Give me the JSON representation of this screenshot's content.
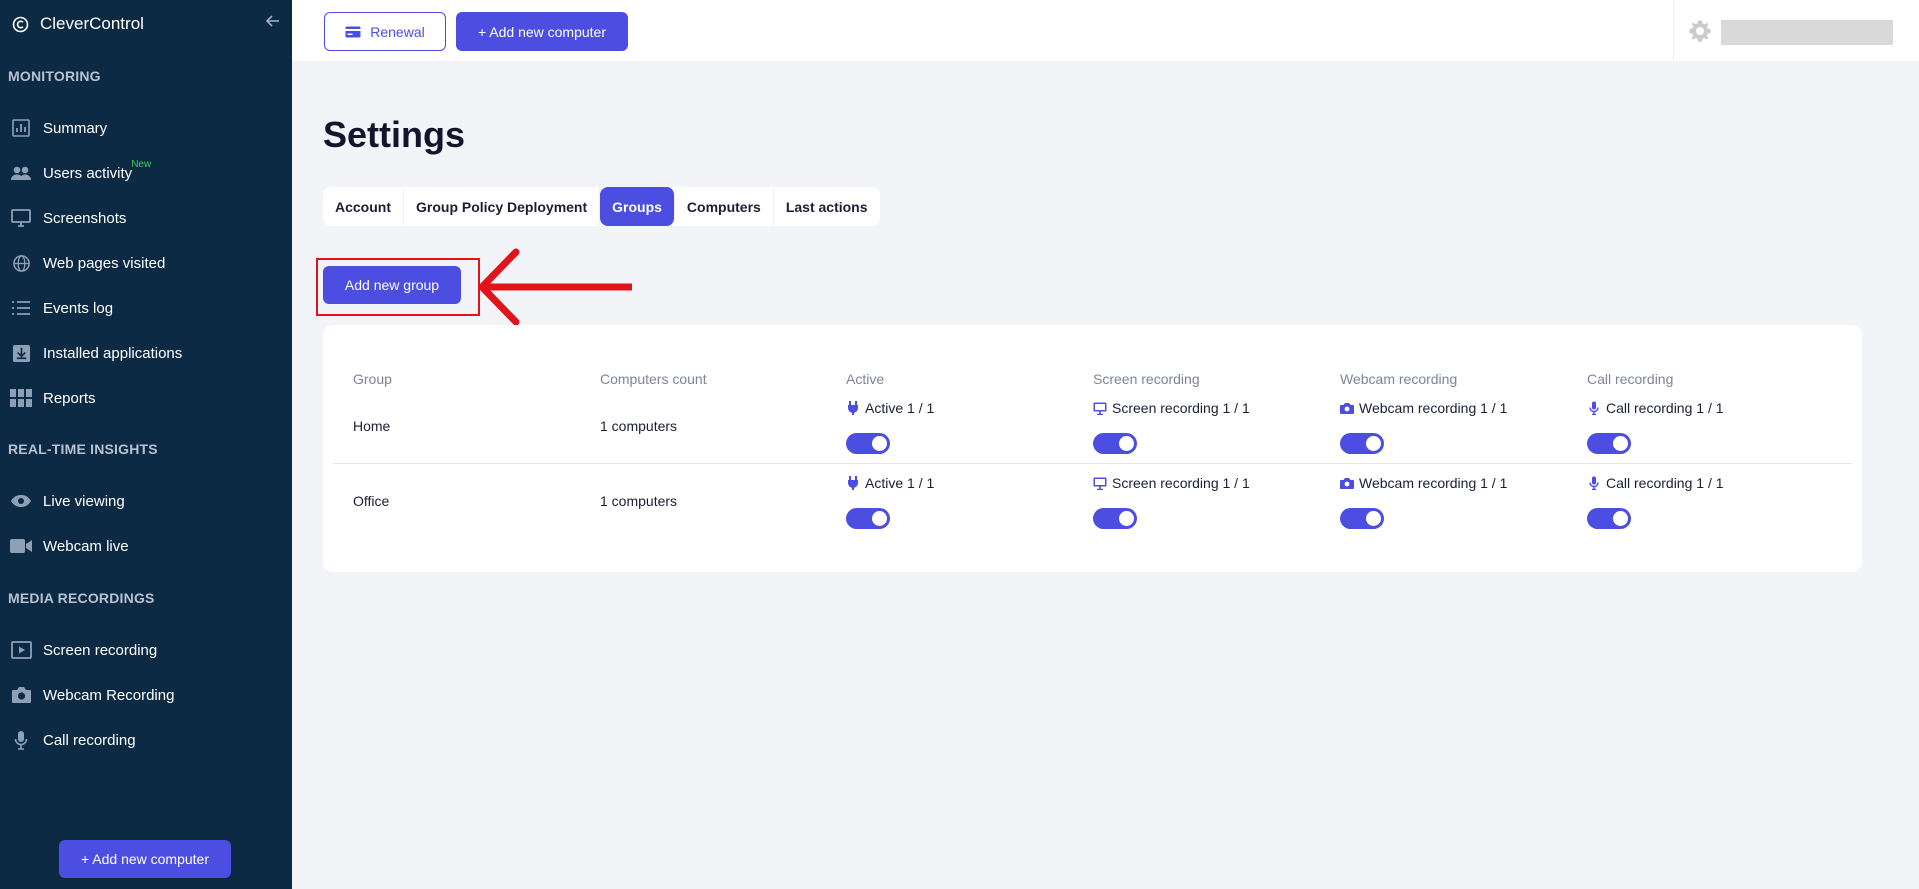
{
  "app": {
    "name": "CleverControl"
  },
  "sidebar": {
    "sections": {
      "monitoring": "MONITORING",
      "realtime": "REAL-TIME INSIGHTS",
      "media": "MEDIA RECORDINGS"
    },
    "items": {
      "summary": "Summary",
      "users_activity": "Users activity",
      "users_activity_badge": "New",
      "screenshots": "Screenshots",
      "web_pages": "Web pages visited",
      "events_log": "Events log",
      "installed_apps": "Installed applications",
      "reports": "Reports",
      "live_viewing": "Live viewing",
      "webcam_live": "Webcam live",
      "screen_recording": "Screen recording",
      "webcam_recording": "Webcam Recording",
      "call_recording": "Call recording"
    },
    "add_button": "+ Add new computer"
  },
  "topbar": {
    "renewal": "Renewal",
    "add_computer": "+ Add new computer"
  },
  "page": {
    "title": "Settings",
    "tabs": [
      "Account",
      "Group Policy Deployment",
      "Groups",
      "Computers",
      "Last actions"
    ],
    "active_tab": "Groups",
    "add_group_button": "Add new group"
  },
  "table": {
    "headers": [
      "Group",
      "Computers count",
      "Active",
      "Screen recording",
      "Webcam recording",
      "Call recording"
    ],
    "rows": [
      {
        "group": "Home",
        "count": "1 computers",
        "active": "Active 1 / 1",
        "screen": "Screen recording 1 / 1",
        "webcam": "Webcam recording 1 / 1",
        "call": "Call recording 1 / 1",
        "toggles": {
          "active": true,
          "screen": true,
          "webcam": true,
          "call": true
        }
      },
      {
        "group": "Office",
        "count": "1 computers",
        "active": "Active 1 / 1",
        "screen": "Screen recording 1 / 1",
        "webcam": "Webcam recording 1 / 1",
        "call": "Call recording 1 / 1",
        "toggles": {
          "active": true,
          "screen": true,
          "webcam": true,
          "call": true
        }
      }
    ]
  },
  "colors": {
    "sidebar_bg": "#0d2a44",
    "accent": "#4b4ee0",
    "annotation_red": "#e0151b",
    "new_badge": "#43c86a"
  },
  "icons": {
    "brand": "clevercontrol-logo-icon",
    "collapse": "arrow-left-icon",
    "summary": "bar-chart-icon",
    "users_activity": "users-icon",
    "screenshots": "monitor-icon",
    "web_pages": "globe-icon",
    "events_log": "list-icon",
    "installed_apps": "download-box-icon",
    "reports": "grid-icon",
    "live_viewing": "eye-icon",
    "webcam_live": "video-camera-icon",
    "screen_recording": "play-screen-icon",
    "webcam_recording": "camera-icon",
    "call_recording": "microphone-icon",
    "renewal": "credit-card-icon",
    "settings": "gear-icon",
    "active": "plug-icon",
    "screen": "desktop-icon",
    "webcam": "camera-icon",
    "call": "microphone-icon"
  }
}
